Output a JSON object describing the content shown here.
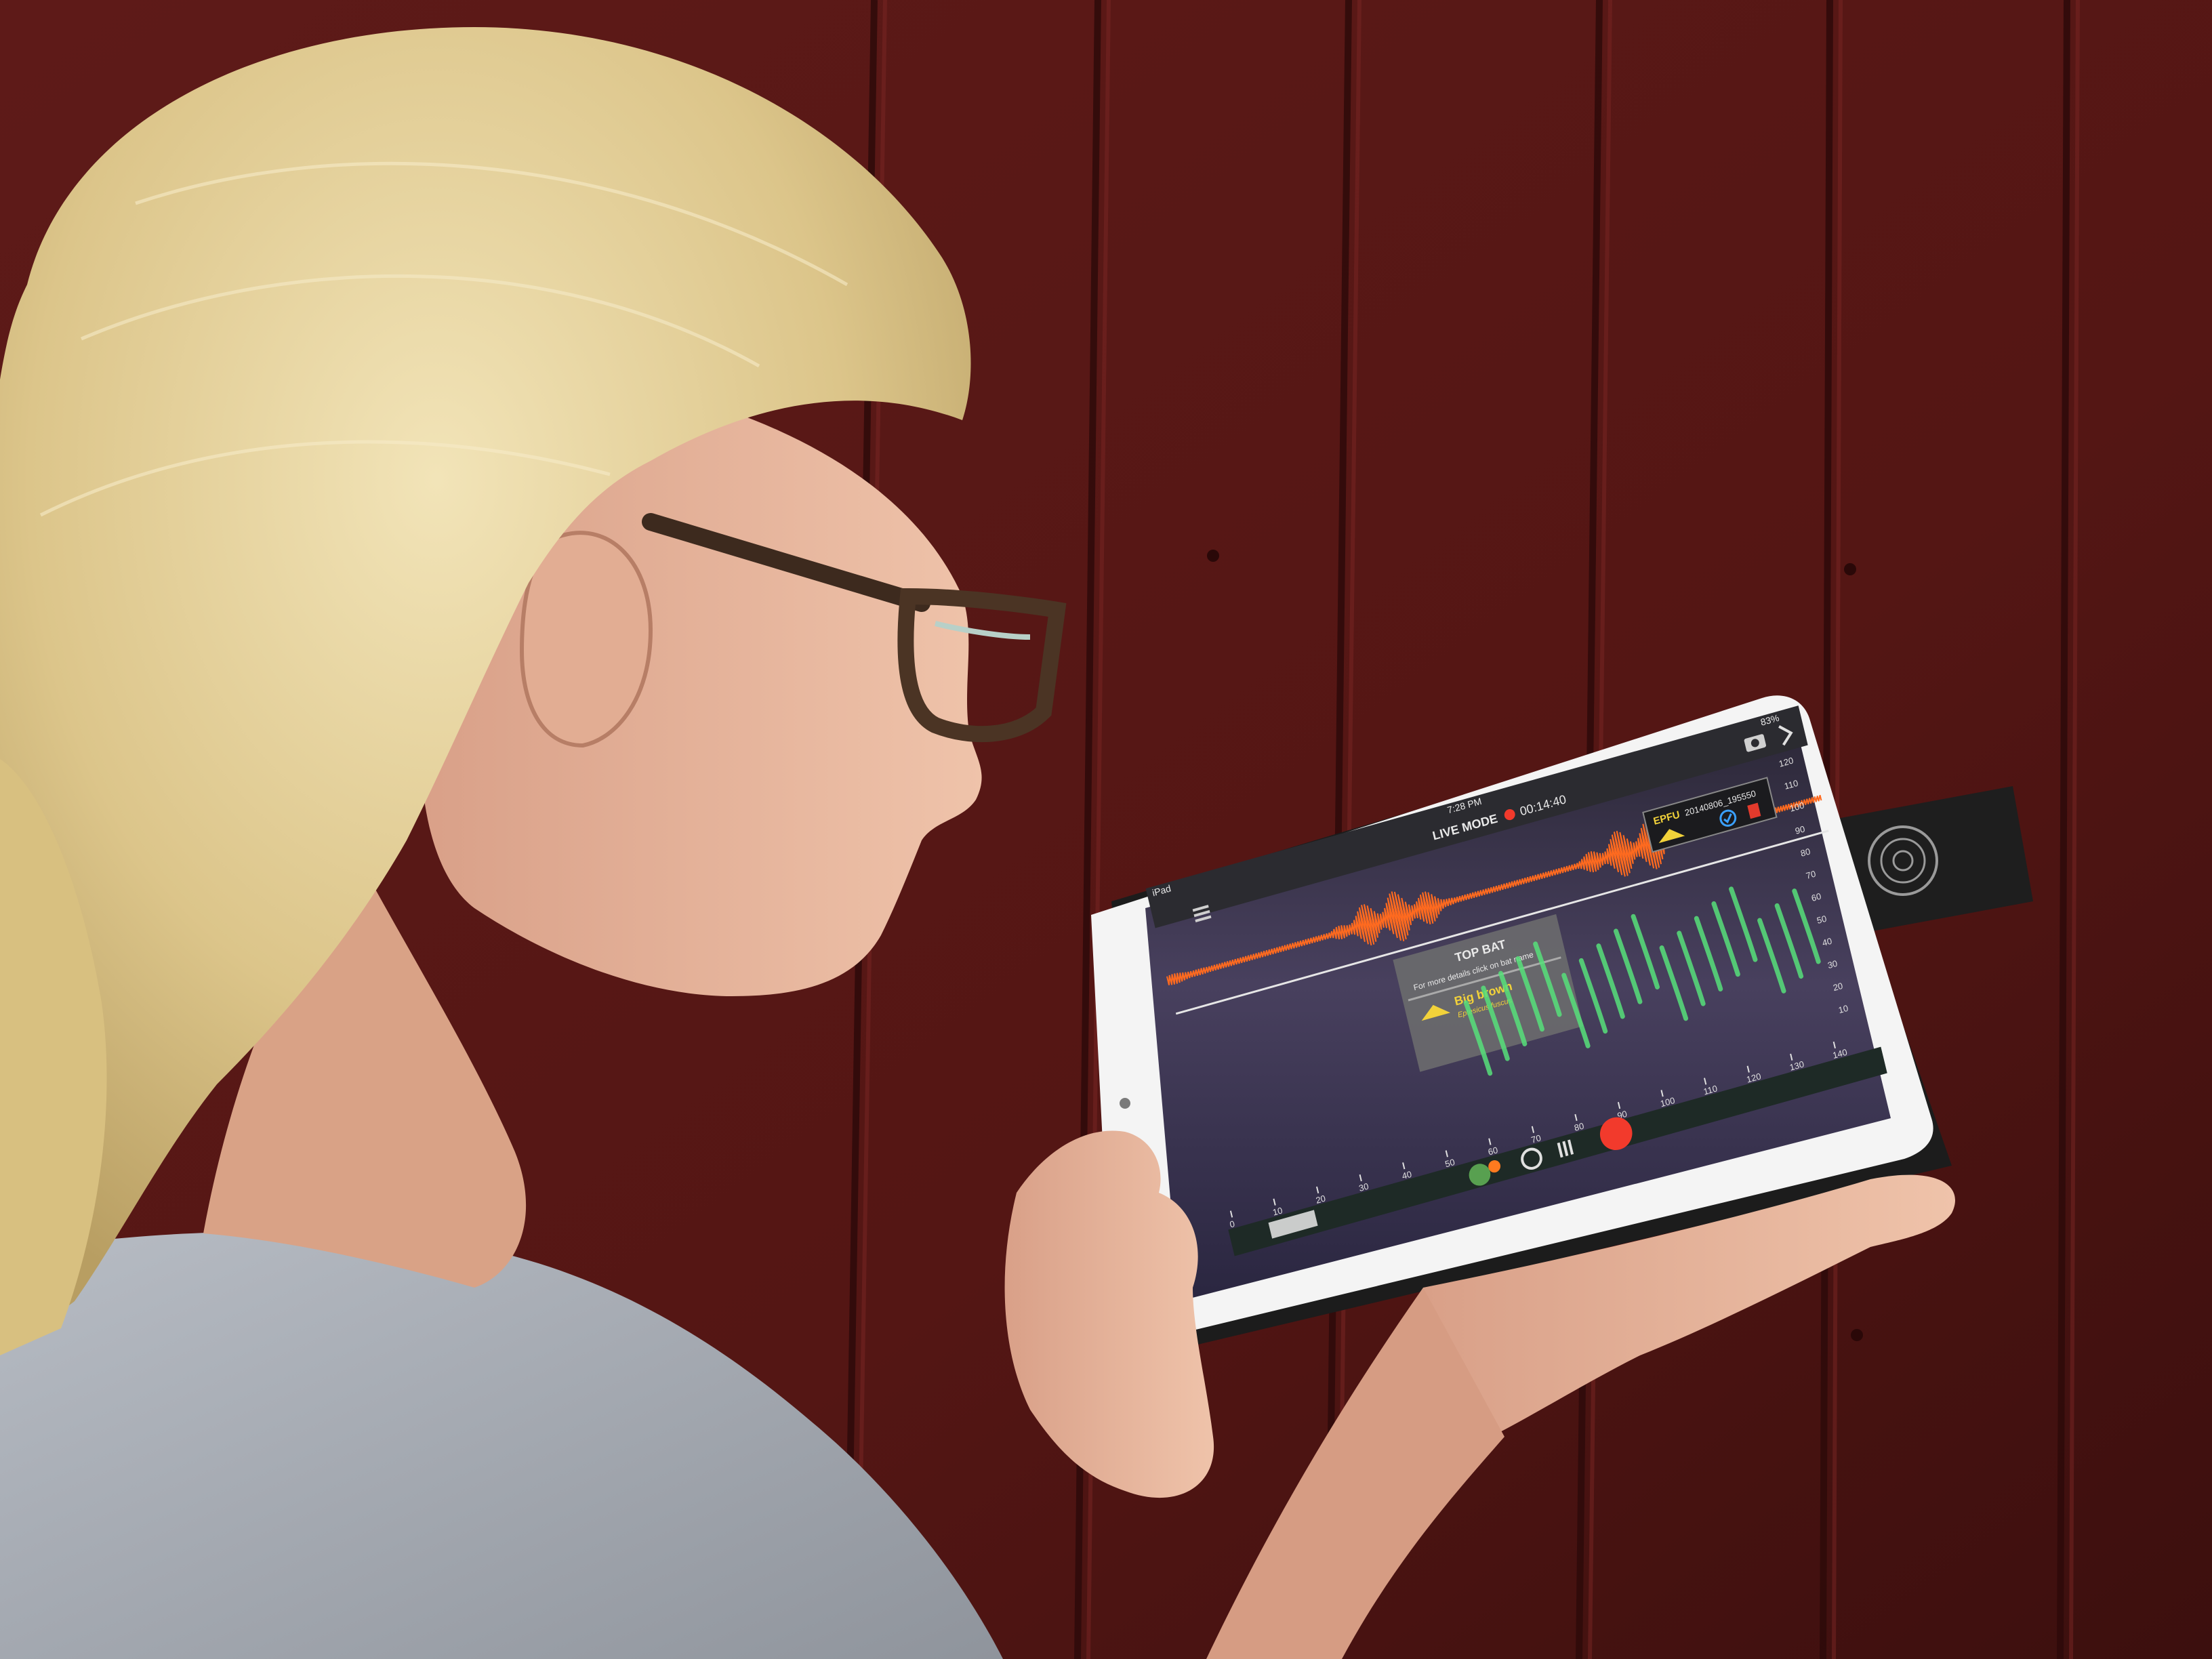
{
  "photo": {
    "colors": {
      "wall": "#5a1818",
      "wall_plank_gap": "#2e0a0a",
      "hair": "#e3cf97",
      "skin": "#e6b59c",
      "shirt": "#a9aeb6",
      "tablet_bezel": "#f4f4f4",
      "case": "#202020",
      "screen_bg": "#3a3550",
      "waveform": "#ff6a1f",
      "spectrogram": "#57e07a",
      "record": "#f23a2c"
    }
  },
  "app": {
    "status": {
      "device": "iPad",
      "time": "7:28 PM",
      "battery": "83%"
    },
    "header": {
      "mode_label": "LIVE MODE",
      "timer": "00:14:40"
    },
    "detection": {
      "code": "EPFU",
      "filename": "20140806_195550"
    },
    "top_bat": {
      "title": "TOP BAT",
      "hint": "For more details click on bat name",
      "species_common": "Big brown",
      "species_latin": "Eptesicus fuscus"
    },
    "freq_axis": {
      "ticks": [
        "120",
        "110",
        "100",
        "90",
        "80",
        "70",
        "60",
        "50",
        "40",
        "30",
        "20",
        "10"
      ]
    },
    "time_axis": {
      "ticks": [
        "0",
        "10",
        "20",
        "30",
        "40",
        "50",
        "60",
        "70",
        "80",
        "90",
        "100",
        "110",
        "120",
        "130",
        "140"
      ]
    },
    "icons": {
      "menu": "hamburger-icon",
      "camera": "camera-icon",
      "next": "chevron-right-icon",
      "signal": "signal-strength-icon",
      "confirm": "checkmark-icon",
      "delete": "trash-icon",
      "record": "record-button"
    }
  },
  "detector": {
    "logo": "echo-meter-touch-logo"
  }
}
